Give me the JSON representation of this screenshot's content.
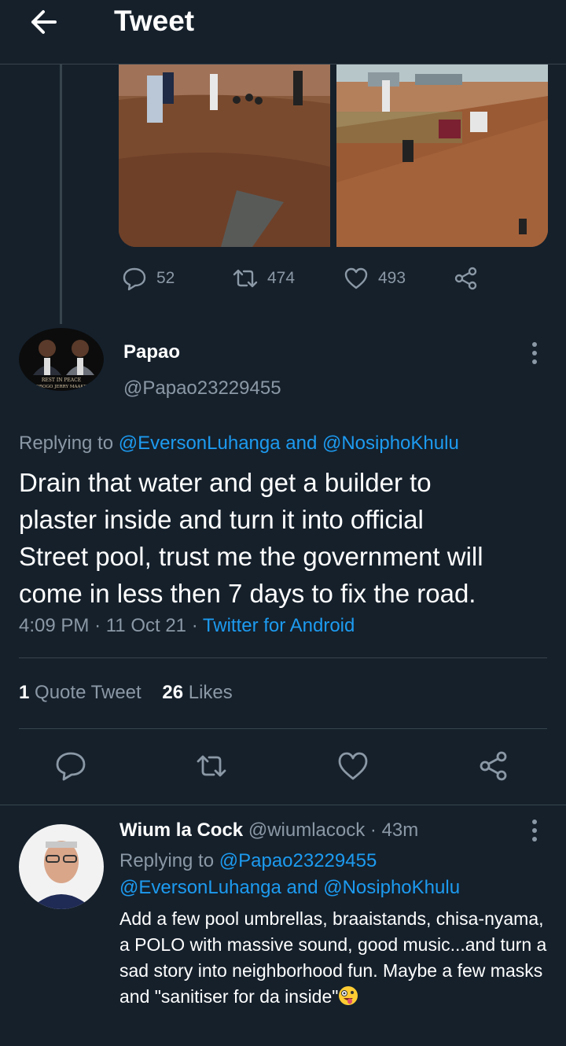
{
  "header": {
    "title": "Tweet"
  },
  "prev_tweet": {
    "stats": {
      "replies": "52",
      "retweets": "474",
      "likes": "493"
    }
  },
  "main_tweet": {
    "author_name": "Papao",
    "author_handle": "@Papao23229455",
    "avatar_caption_1": "REST IN PEACE",
    "avatar_caption_2": "OBOGO  JERRY MAAKE",
    "replying_prefix": "Replying to",
    "replying_user_1": "@EversonLuhanga",
    "replying_and": "and",
    "replying_user_2": "@NosiphoKhulu",
    "text_lines": [
      "Drain that water and get a builder to",
      "plaster inside and turn it into official",
      "Street pool, trust me the government will",
      "come in less then 7 days to fix the road."
    ],
    "time": "4:09 PM",
    "date": "11 Oct 21",
    "sep": "·",
    "client": "Twitter for Android",
    "quote_count": "1",
    "quote_label": "Quote Tweet",
    "likes_count": "26",
    "likes_label": "Likes"
  },
  "reply": {
    "author_name": "Wium la Cock",
    "author_handle": "@wiumlacock",
    "sep": "·",
    "time": "43m",
    "replying_prefix": "Replying to",
    "replying_user_1": "@Papao23229455",
    "replying_user_2": "@EversonLuhanga",
    "replying_and": "and",
    "replying_user_3": "@NosiphoKhulu",
    "text": "Add a few pool umbrellas, braaistands, chisa-nyama, a POLO with massive sound, good music...and turn a sad story into neighborhood fun. Maybe a few masks and \"sanitiser for da inside\""
  },
  "colors": {
    "background": "#15202b",
    "link": "#1d9bf0",
    "secondary_text": "#8b98a5",
    "divider": "#38444d"
  },
  "icons": [
    "back-arrow-icon",
    "reply-icon",
    "retweet-icon",
    "like-icon",
    "share-icon",
    "more-icon",
    "zany-face-emoji"
  ]
}
